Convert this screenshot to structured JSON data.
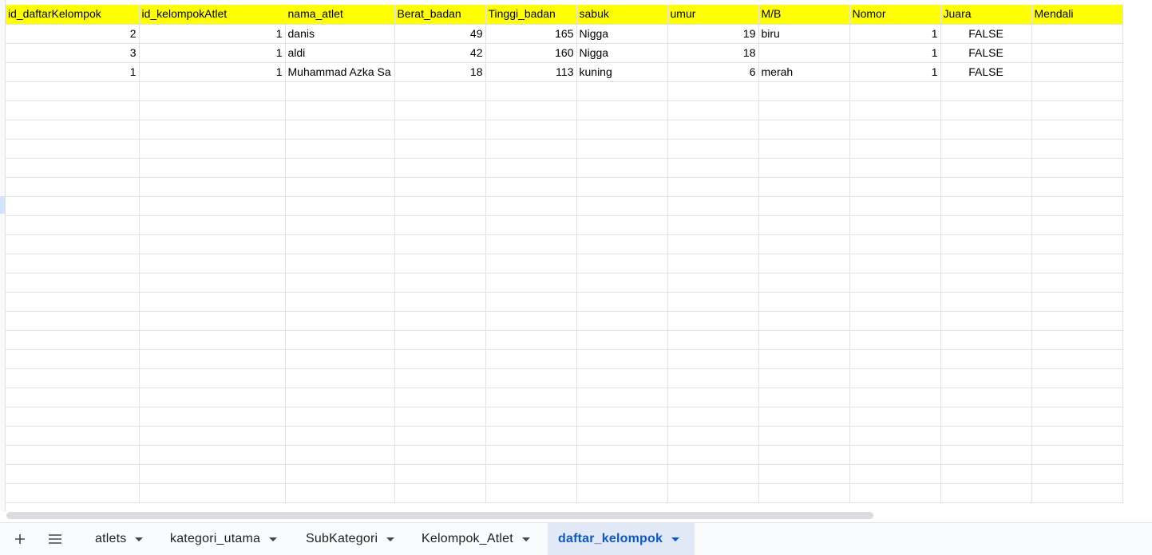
{
  "sheet": {
    "columns": [
      "id_daftarKelompok",
      "id_kelompokAtlet",
      "nama_atlet",
      "Berat_badan",
      "Tinggi_badan",
      "sabuk",
      "umur",
      "M/B",
      "Nomor",
      "Juara",
      "Mendali"
    ],
    "rows": [
      [
        "2",
        "1",
        "danis",
        "49",
        "165",
        "Nigga",
        "19",
        "biru",
        "1",
        "FALSE",
        ""
      ],
      [
        "3",
        "1",
        "aldi",
        "42",
        "160",
        "Nigga",
        "18",
        "",
        "1",
        "FALSE",
        ""
      ],
      [
        "1",
        "1",
        "Muhammad Azka Sa",
        "18",
        "113",
        "kuning",
        "6",
        "merah",
        "1",
        "FALSE",
        ""
      ]
    ],
    "header_color": "#ffff00"
  },
  "tabbar": {
    "add_icon": "plus-icon",
    "menu_icon": "hamburger-menu-icon",
    "tabs": [
      {
        "label": "atlets",
        "active": false
      },
      {
        "label": "kategori_utama",
        "active": false
      },
      {
        "label": "SubKategori",
        "active": false
      },
      {
        "label": "Kelompok_Atlet",
        "active": false
      },
      {
        "label": "daftar_kelompok",
        "active": true
      }
    ],
    "active_color": "#0b57d0"
  }
}
